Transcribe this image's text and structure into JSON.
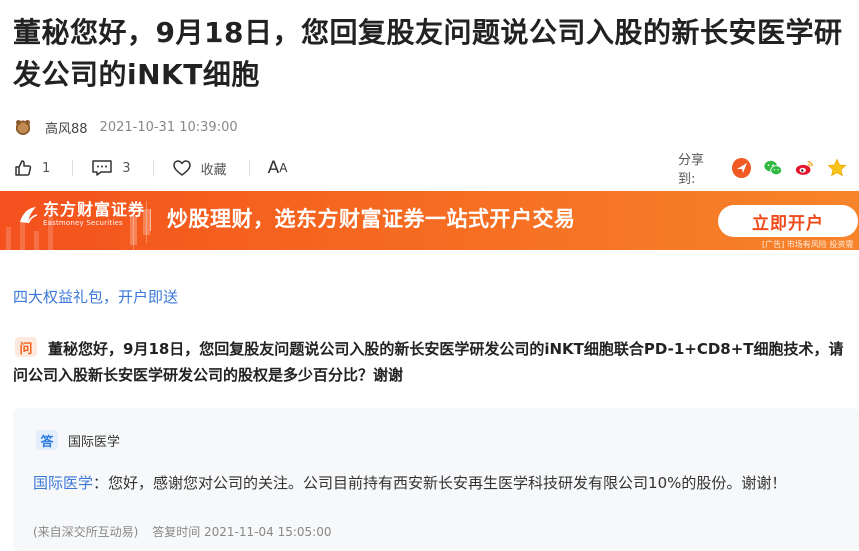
{
  "article": {
    "title": "董秘您好，9月18日，您回复股友问题说公司入股的新长安医学研发公司的iNKT细胞",
    "author": "高风88",
    "time": "2021-10-31 10:39:00"
  },
  "actions": {
    "like_count": "1",
    "comment_count": "3",
    "collect_label": "收藏",
    "font_big": "A",
    "font_small": "A",
    "share_label": "分享到:"
  },
  "banner": {
    "logo_cn": "东方财富证券",
    "logo_en": "Eastmoney Securities",
    "slogan": "炒股理财，选东方财富证券一站式开户交易",
    "button": "立即开户",
    "ad_note": "[广告] 市场有风险 投资需"
  },
  "promo": {
    "text": "四大权益礼包，开户即送"
  },
  "qa": {
    "question_badge": "问",
    "question": "董秘您好，9月18日，您回复股友问题说公司入股的新长安医学研发公司的iNKT细胞联合PD-1+CD8+T细胞技术，请问公司入股新长安医学研发公司的股权是多少百分比？谢谢",
    "answer_badge": "答",
    "answerer": "国际医学",
    "answer_who": "国际医学",
    "answer": "：您好，感谢您对公司的关注。公司目前持有西安新长安再生医学科技研发有限公司10%的股份。谢谢！",
    "source": "(来自深交所互动易)",
    "reply_time": "答复时间 2021-11-04 15:05:00"
  },
  "colors": {
    "banner_orange": "#f4511e",
    "link_blue": "#3b78d8",
    "question_accent": "#f0601e",
    "answer_accent": "#2f7de1"
  }
}
